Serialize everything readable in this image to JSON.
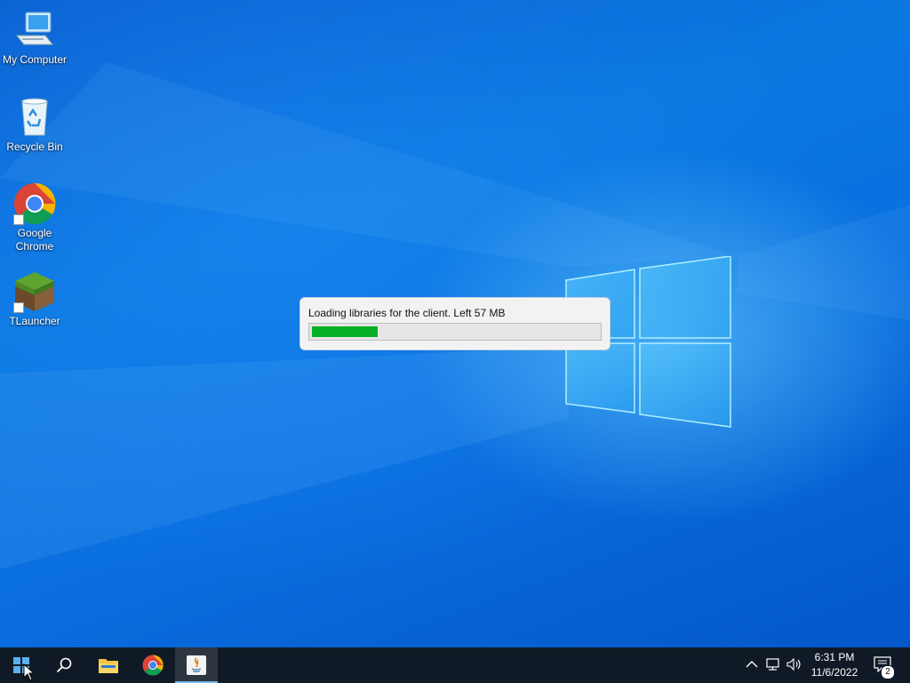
{
  "desktop": {
    "icons": [
      {
        "label": "My Computer",
        "icon": "computer-icon"
      },
      {
        "label": "Recycle Bin",
        "icon": "recycle-bin-icon"
      },
      {
        "label": "Google Chrome",
        "icon": "chrome-icon"
      },
      {
        "label": "TLauncher",
        "icon": "tlauncher-icon"
      }
    ]
  },
  "loader": {
    "message": "Loading libraries for the client. Left 57 MB",
    "progress_fraction": 0.23,
    "progress_color": "#06b025"
  },
  "taskbar": {
    "buttons": [
      {
        "name": "start-button",
        "icon": "windows-logo-icon"
      },
      {
        "name": "search-button",
        "icon": "search-icon"
      },
      {
        "name": "file-explorer-button",
        "icon": "folder-icon"
      },
      {
        "name": "chrome-taskbar-button",
        "icon": "chrome-icon"
      },
      {
        "name": "java-taskbar-button",
        "icon": "java-icon",
        "active": true
      }
    ],
    "tray": {
      "time": "6:31 PM",
      "date": "11/6/2022",
      "notification_count": "2"
    }
  }
}
